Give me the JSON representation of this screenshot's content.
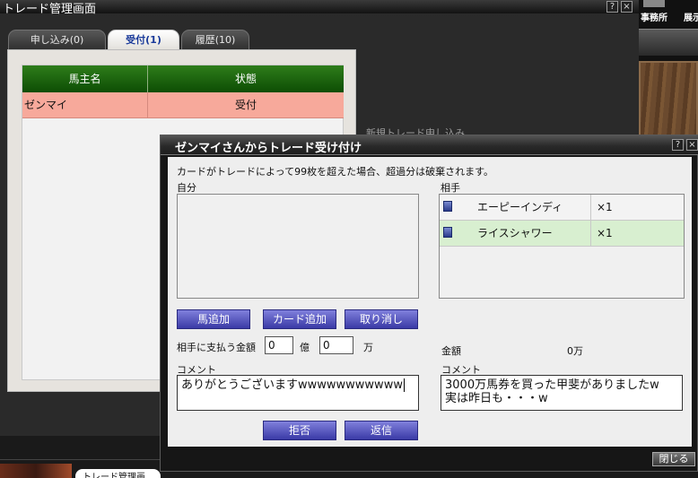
{
  "bg_window": {
    "title": "トレード管理画面",
    "help_icon": "?",
    "close_icon": "×",
    "tabs": [
      {
        "label": "申し込み(0)",
        "active": false
      },
      {
        "label": "受付(1)",
        "active": true
      },
      {
        "label": "履歴(10)",
        "active": false
      }
    ],
    "table": {
      "columns": [
        "馬主名",
        "状態"
      ],
      "rows": [
        {
          "owner": "ゼンマイ",
          "status": "受付"
        }
      ]
    },
    "behind_text": "新規トレード申し込み"
  },
  "right_strip": {
    "office_label": "事務所",
    "display_label": "展示"
  },
  "taskbar": {
    "tab_label": "トレード管理画"
  },
  "dialog": {
    "title": "ゼンマイさんからトレード受け付け",
    "help_icon": "?",
    "close_icon": "×",
    "notice": "カードがトレードによって99枚を超えた場合、超過分は破棄されます。",
    "self_label": "自分",
    "partner_label": "相手",
    "partner_items": [
      {
        "name": "エーピーインディ",
        "qty": "×1"
      },
      {
        "name": "ライスシャワー",
        "qty": "×1"
      }
    ],
    "buttons": {
      "add_horse": "馬追加",
      "add_card": "カード追加",
      "cancel": "取り消し",
      "reject": "拒否",
      "reply": "返信",
      "close": "閉じる"
    },
    "pay_label": "相手に支払う金額",
    "oku_value": "0",
    "oku_unit": "億",
    "man_value": "0",
    "man_unit": "万",
    "amount_label": "金額",
    "amount_value": "0万",
    "self_comment_label": "コメント",
    "self_comment": "ありがとうございますwwwwwwwwwww",
    "partner_comment_label": "コメント",
    "partner_comment_line1": "3000万馬券を買った甲斐がありましたw",
    "partner_comment_line2": "実は昨日も・・・w"
  },
  "colors": {
    "header_green": "#0d4d04",
    "row_salmon": "#f7a99b",
    "button_blue": "#3a3aa6",
    "selected_row": "#d8efd0"
  }
}
